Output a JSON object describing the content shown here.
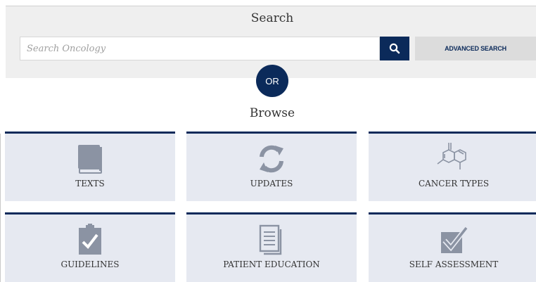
{
  "search": {
    "title": "Search",
    "placeholder": "Search Oncology",
    "value": "",
    "advanced_label": "ADVANCED SEARCH"
  },
  "divider": {
    "or_label": "OR"
  },
  "browse": {
    "title": "Browse",
    "tiles": [
      {
        "label": "TEXTS",
        "icon": "book-icon"
      },
      {
        "label": "UPDATES",
        "icon": "refresh-icon"
      },
      {
        "label": "CANCER TYPES",
        "icon": "molecule-icon"
      },
      {
        "label": "GUIDELINES",
        "icon": "clipboard-check-icon"
      },
      {
        "label": "PATIENT EDUCATION",
        "icon": "document-icon"
      },
      {
        "label": "SELF ASSESSMENT",
        "icon": "checkbox-icon"
      }
    ]
  },
  "colors": {
    "navy": "#0b2a5a",
    "tile_bg": "#e6e9f1",
    "icon_gray": "#8b93a3",
    "panel_bg": "#efefef"
  }
}
